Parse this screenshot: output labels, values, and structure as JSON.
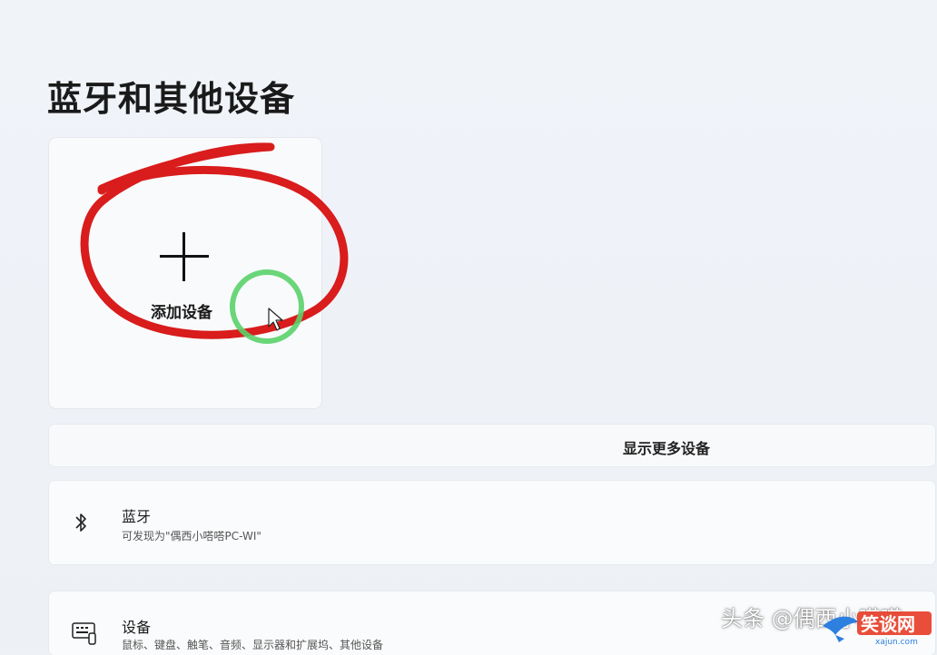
{
  "page": {
    "title": "蓝牙和其他设备"
  },
  "add_device": {
    "label": "添加设备",
    "icon": "plus-icon"
  },
  "more_devices": {
    "label": "显示更多设备"
  },
  "bluetooth": {
    "title": "蓝牙",
    "subtitle": "可发现为\"偶西小嗒嗒PC-WI\"",
    "icon": "bluetooth-icon"
  },
  "devices": {
    "title": "设备",
    "subtitle": "鼠标、键盘、触笔、音频、显示器和扩展坞、其他设备",
    "icon": "keyboard-icon"
  },
  "overlay": {
    "watermark": "头条 @偶西小嗒嗒",
    "site_logo_text": "笑谈网",
    "site_logo_url_text": "xajun.com"
  },
  "colors": {
    "annotation_red": "#d91c1c",
    "annotation_green": "#5ad16a"
  }
}
